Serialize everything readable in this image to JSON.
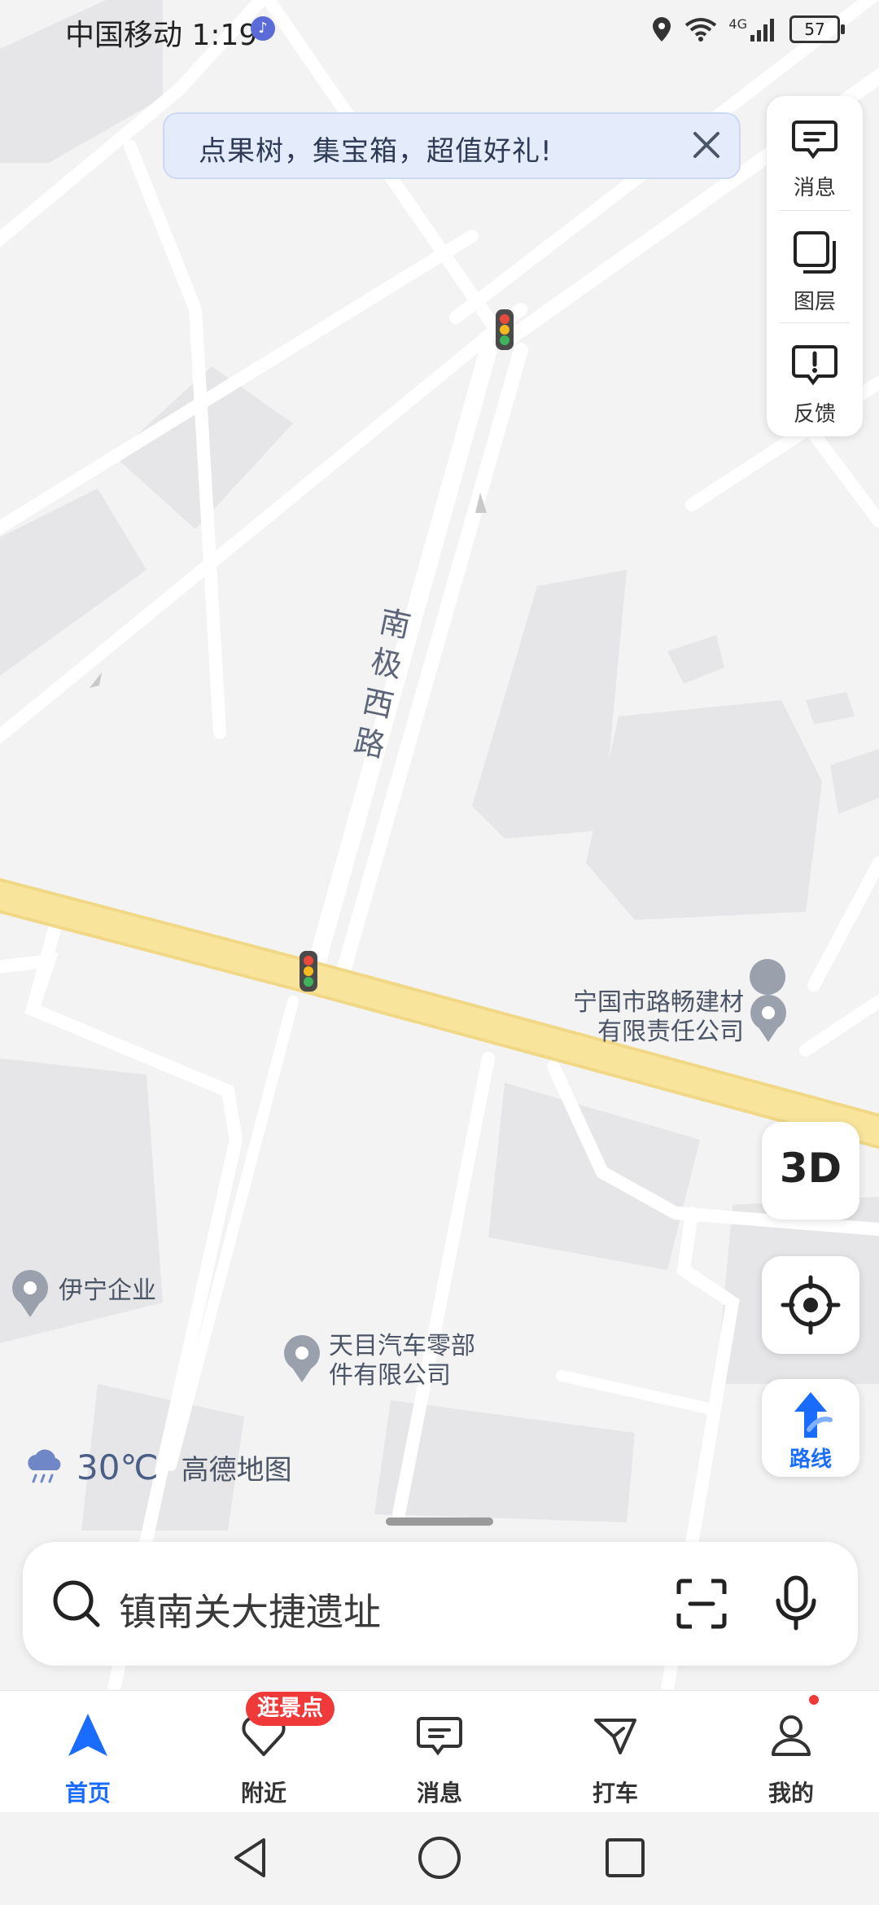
{
  "status_bar": {
    "carrier_time": "中国移动 1:19",
    "network": "4G",
    "battery": "57"
  },
  "banner": {
    "text": "点果树，集宝箱，超值好礼!"
  },
  "tools": [
    {
      "label": "消息",
      "icon": "message-icon"
    },
    {
      "label": "图层",
      "icon": "layers-icon"
    },
    {
      "label": "反馈",
      "icon": "feedback-icon"
    }
  ],
  "map": {
    "road_name": "南极西路",
    "pois": [
      {
        "line1": "宁国市路畅建材",
        "line2": "有限责任公司"
      },
      {
        "line1": "伊宁企业",
        "line2": ""
      },
      {
        "line1": "天目汽车零部",
        "line2": "件有限公司"
      }
    ],
    "btn_3d": "3D",
    "route_label": "路线",
    "weather_temp": "30℃",
    "brand": "高德地图"
  },
  "search": {
    "placeholder": "镇南关大捷遗址"
  },
  "nav": {
    "items": [
      {
        "label": "首页",
        "icon": "home-arrow-icon",
        "active": true
      },
      {
        "label": "附近",
        "icon": "nearby-heart-icon"
      },
      {
        "label": "消息",
        "icon": "message-icon"
      },
      {
        "label": "打车",
        "icon": "taxi-icon"
      },
      {
        "label": "我的",
        "icon": "profile-icon"
      }
    ],
    "nearby_badge": "逛景点"
  },
  "colors": {
    "accent": "#1a6cff",
    "main_road": "#f7e08e",
    "badge": "#f03a3a"
  }
}
